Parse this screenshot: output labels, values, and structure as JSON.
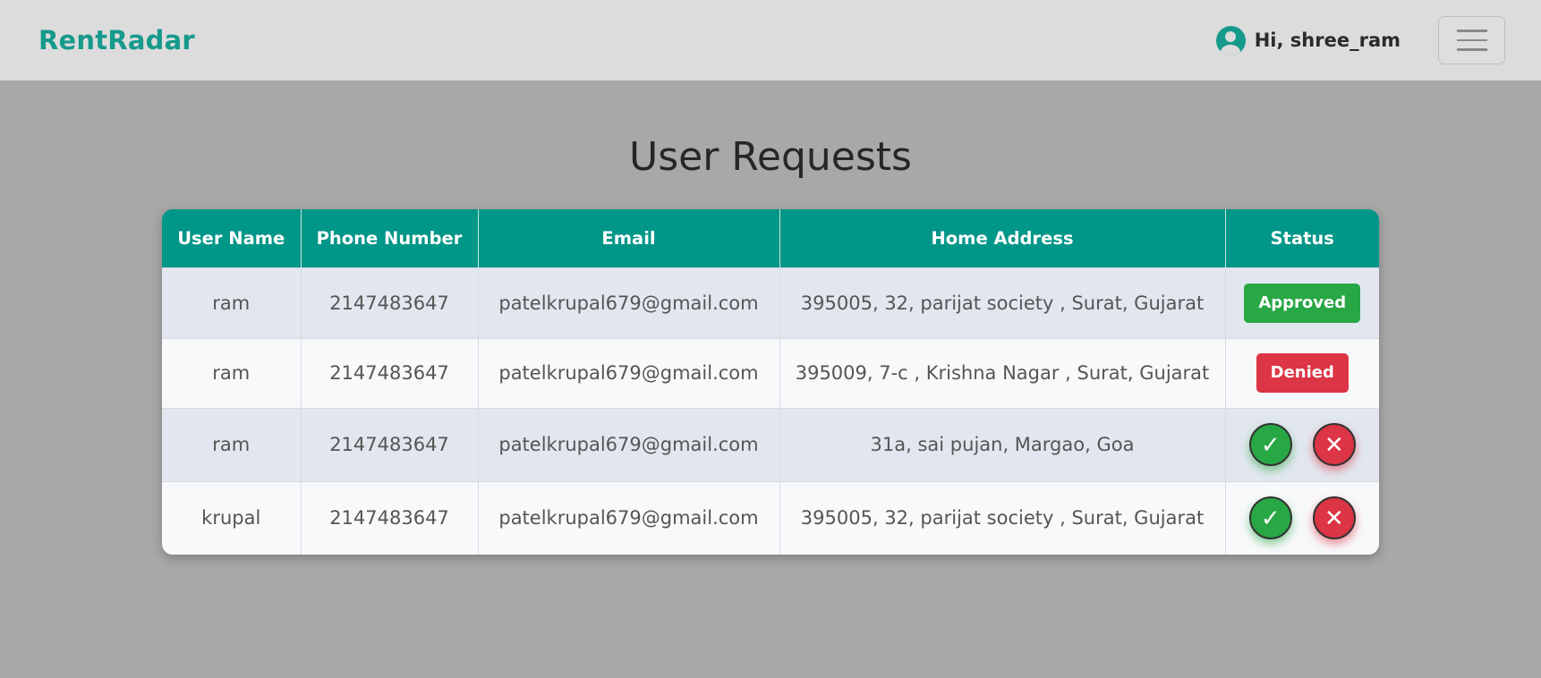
{
  "navbar": {
    "brand": "RentRadar",
    "greeting": "Hi, shree_ram",
    "user_icon": "user-circle-icon",
    "menu_icon": "hamburger-icon"
  },
  "page": {
    "title": "User Requests"
  },
  "table": {
    "headers": [
      "User Name",
      "Phone Number",
      "Email",
      "Home Address",
      "Status"
    ],
    "rows": [
      {
        "user_name": "ram",
        "phone": "2147483647",
        "email": "patelkrupal679@gmail.com",
        "address": "395005, 32, parijat society , Surat, Gujarat",
        "status": "Approved"
      },
      {
        "user_name": "ram",
        "phone": "2147483647",
        "email": "patelkrupal679@gmail.com",
        "address": "395009, 7-c , Krishna Nagar , Surat, Gujarat",
        "status": "Denied"
      },
      {
        "user_name": "ram",
        "phone": "2147483647",
        "email": "patelkrupal679@gmail.com",
        "address": "31a, sai pujan, Margao, Goa",
        "status": ""
      },
      {
        "user_name": "krupal",
        "phone": "2147483647",
        "email": "patelkrupal679@gmail.com",
        "address": "395005, 32, parijat society , Surat, Gujarat",
        "status": ""
      }
    ],
    "accept_glyph": "✓",
    "reject_glyph": "✕"
  },
  "colors": {
    "brand": "#159a8c",
    "header": "#009688",
    "approved": "#28a745",
    "denied": "#dc3545"
  }
}
